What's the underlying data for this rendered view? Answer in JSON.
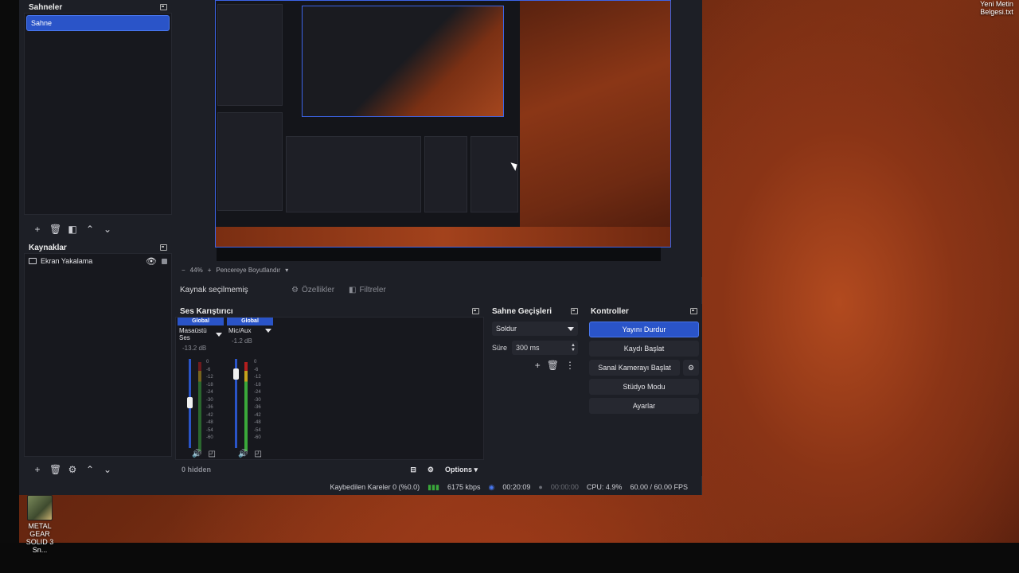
{
  "desktop": {
    "icons": [
      {
        "label": "METAL GEAR SOLID 3 Sn..."
      },
      {
        "label": "Yeni Metin Belgesi.txt"
      }
    ]
  },
  "scenes": {
    "title": "Sahneler",
    "items": [
      {
        "label": "Sahne",
        "selected": true
      }
    ]
  },
  "sources": {
    "title": "Kaynaklar",
    "items": [
      {
        "label": "Ekran Yakalama",
        "visible": true,
        "locked": true
      }
    ]
  },
  "preview": {
    "zoom": "44%",
    "fit_mode": "Pencereye Boyutlandır"
  },
  "context_bar": {
    "no_source": "Kaynak seçilmemiş",
    "properties": "Özellikler",
    "filters": "Filtreler"
  },
  "mixer": {
    "title": "Ses Karıştırıcı",
    "channels": [
      {
        "scope": "Global",
        "name": "Masaüstü Ses",
        "db": "-13.2 dB",
        "level": 0.62
      },
      {
        "scope": "Global",
        "name": "Mic/Aux",
        "db": "-1.2 dB",
        "level": 0.95
      }
    ],
    "ticks": [
      "0",
      "-6",
      "-12",
      "-18",
      "-24",
      "-30",
      "-36",
      "-42",
      "-48",
      "-54",
      "-60"
    ],
    "hidden_label": "0 hidden",
    "options_label": "Options"
  },
  "transitions": {
    "title": "Sahne Geçişleri",
    "selected": "Soldur",
    "duration_label": "Süre",
    "duration_value": "300 ms"
  },
  "controls": {
    "title": "Kontroller",
    "stop_stream": "Yayını Durdur",
    "start_recording": "Kaydı Başlat",
    "start_virtual_cam": "Sanal Kamerayı Başlat",
    "studio_mode": "Stüdyo Modu",
    "settings": "Ayarlar"
  },
  "status": {
    "dropped_frames": "Kaybedilen Kareler 0 (%0.0)",
    "bitrate": "6175 kbps",
    "stream_time": "00:20:09",
    "record_time": "00:00:00",
    "cpu": "CPU: 4.9%",
    "fps": "60.00 / 60.00 FPS"
  },
  "colors": {
    "accent": "#2a54c8",
    "panel": "#1d1f26"
  }
}
